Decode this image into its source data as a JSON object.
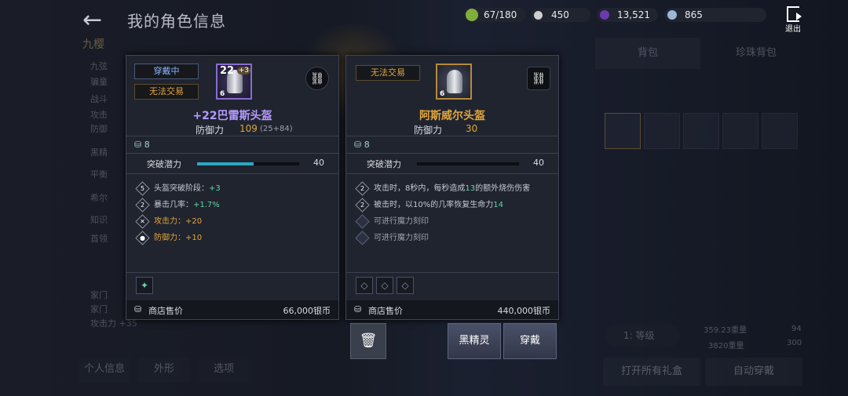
{
  "header": {
    "back_icon": "arrow-left-icon",
    "title": "我的角色信息",
    "resources": [
      {
        "icon": "bag-capacity-icon",
        "value": "67/180",
        "color": "#7fae3c"
      },
      {
        "icon": "silver-coin-icon",
        "value": "450",
        "color": "#cfcfcf"
      },
      {
        "icon": "black-pearl-icon",
        "value": "13,521",
        "color": "#6a3bb0"
      },
      {
        "icon": "crystal-icon",
        "value": "865",
        "color": "#9bb7d8"
      }
    ],
    "exit_label": "退出"
  },
  "left_panel": {
    "name": "九樱",
    "rows": [
      "九弦",
      "骗童",
      "战斗",
      "攻击",
      "防御",
      "黑精",
      "平衡",
      "希尔",
      "知识",
      "首领",
      "家门",
      "家门",
      "攻击力 +35"
    ],
    "tabs": [
      "个人信息",
      "外形",
      "选项"
    ]
  },
  "right_panel": {
    "tabs": [
      "背包",
      "珍珠背包"
    ],
    "level_label": "1: 等级",
    "weight_current": "359.23重量",
    "weight_max": "3820重量",
    "slots_current": "94",
    "slots_max": "300",
    "open_all_label": "打开所有礼盒",
    "auto_equip_label": "自动穿戴"
  },
  "equipped_card": {
    "status_tag": "穿戴中",
    "trade_tag": "无法交易",
    "enhance": "22",
    "enhance_plus": "+3",
    "grade": "6",
    "name": "+22巴雷斯头盔",
    "name_color": "#b59bff",
    "defense_label": "防御力",
    "defense_value": "109",
    "defense_detail": "(25+84)",
    "weight": "8",
    "potential_label": "突破潜力",
    "potential_value": "40",
    "potential_fill": 0.55,
    "effects": [
      {
        "badge": "5",
        "text": "头盔突破阶段：",
        "value": "+3",
        "style": "normal"
      },
      {
        "badge": "2",
        "text": "暴击几率：",
        "value": "+1.7%",
        "style": "normal"
      },
      {
        "badge": "✕",
        "text": "攻击力：",
        "value": "+20",
        "style": "gold"
      },
      {
        "badge": "●",
        "text": "防御力：",
        "value": "+10",
        "style": "gold"
      }
    ],
    "price_label": "商店售价",
    "price_value": "66,000银币"
  },
  "compare_card": {
    "trade_tag": "无法交易",
    "grade": "6",
    "name": "阿斯威尔头盔",
    "name_color": "#e0a63c",
    "defense_label": "防御力",
    "defense_value": "30",
    "weight": "8",
    "potential_label": "突破潜力",
    "potential_value": "40",
    "potential_fill": 0,
    "effects": [
      {
        "badge": "2",
        "pre": "攻击时，8秒内，每秒造成",
        "hl": "13",
        "post": "的额外烧伤伤害"
      },
      {
        "badge": "2",
        "pre": "被击时，以10%的几率恢复生命力",
        "hl": "14",
        "post": ""
      },
      {
        "badge": "",
        "pre": "可进行魔力刻印",
        "hl": "",
        "post": ""
      },
      {
        "badge": "",
        "pre": "可进行魔力刻印",
        "hl": "",
        "post": ""
      }
    ],
    "price_label": "商店售价",
    "price_value": "440,000银币"
  },
  "actions": {
    "trash_icon": "trash-icon",
    "black_spirit_label": "黑精灵",
    "equip_label": "穿戴"
  }
}
